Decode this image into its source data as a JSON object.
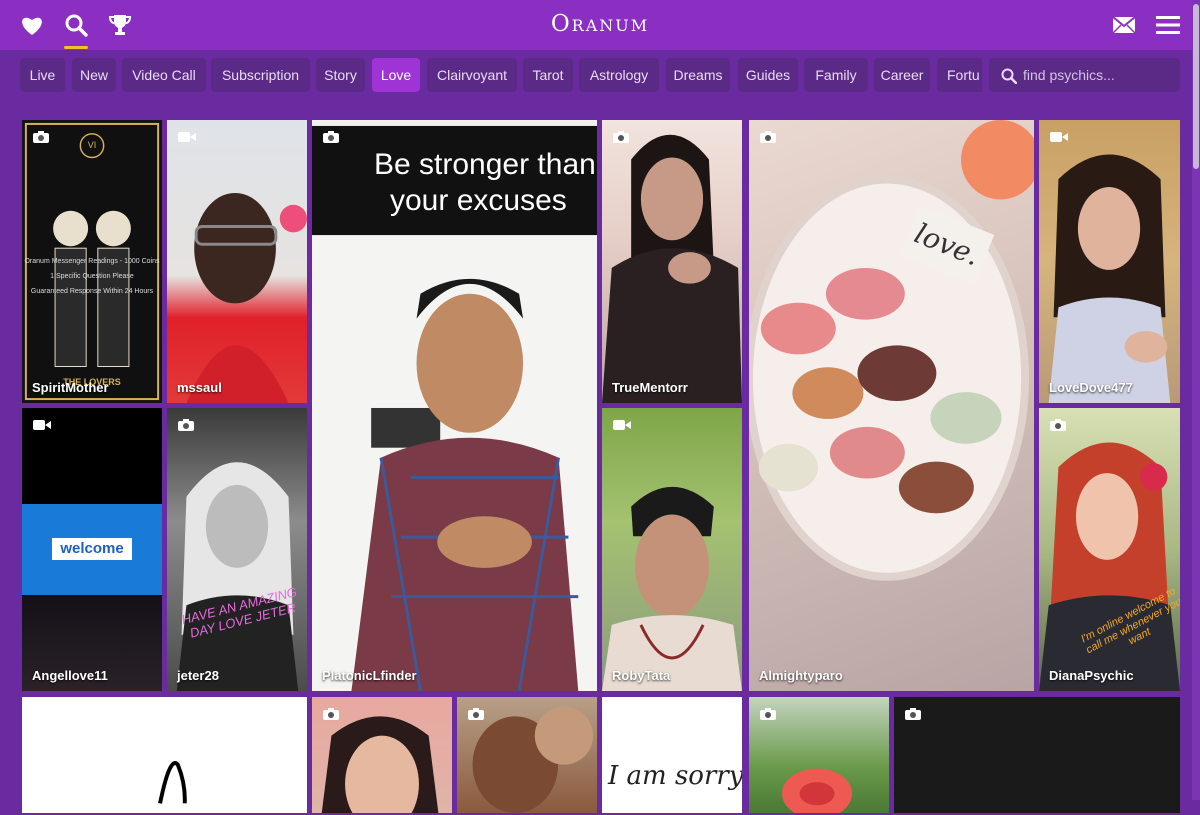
{
  "app": {
    "logo": "Oranum"
  },
  "topbar": {
    "icons": [
      "heart-icon",
      "search-icon",
      "trophy-icon",
      "mail-icon",
      "menu-icon"
    ],
    "active": "search-icon"
  },
  "filters": {
    "chips": [
      "Live",
      "New",
      "Video Call",
      "Subscription",
      "Story",
      "Love",
      "Clairvoyant",
      "Tarot",
      "Astrology",
      "Dreams",
      "Guides",
      "Family",
      "Career",
      "Fortu"
    ],
    "active": "Love"
  },
  "search": {
    "placeholder": "find psychics..."
  },
  "tiles": [
    {
      "name": "SpiritMother",
      "media": "camera-icon"
    },
    {
      "name": "mssaul",
      "media": "video-icon"
    },
    {
      "name": "PlatonicLfinder",
      "media": "camera-icon"
    },
    {
      "name": "TrueMentorr",
      "media": "camera-icon"
    },
    {
      "name": "Almightyparo",
      "media": "camera-icon"
    },
    {
      "name": "LoveDove477",
      "media": "video-icon"
    },
    {
      "name": "Angellove11",
      "media": "video-icon"
    },
    {
      "name": "jeter28",
      "media": "camera-icon"
    },
    {
      "name": "RobyTata",
      "media": "video-icon"
    },
    {
      "name": "DianaPsychic",
      "media": "camera-icon"
    },
    {
      "name": "",
      "media": ""
    },
    {
      "name": "",
      "media": "camera-icon"
    },
    {
      "name": "",
      "media": "camera-icon"
    },
    {
      "name": "",
      "media": ""
    },
    {
      "name": "",
      "media": "camera-icon"
    },
    {
      "name": "",
      "media": "camera-icon"
    }
  ],
  "tile_texts": {
    "tarot_lines": [
      "Oranum Messenger Readings - 1000 Coins",
      "1 Specific Question Please",
      "Guaranteed Response Within 24 Hours"
    ],
    "tarot_numeral": "VI",
    "tarot_card": "THE LOVERS",
    "quote_line1": "Be stronger than",
    "quote_line2": "your excuses",
    "welcome": "welcome",
    "jeter_overlay": "HAVE AN AMAZING DAY LOVE JETER",
    "diana_overlay": "I'm online welcome to call me whenever you want",
    "love_tag": "love.",
    "sorry": "I am sorry."
  },
  "colors": {
    "topbar": "#8a2fc2",
    "background": "#6a2aa0",
    "chip": "#5b2a86",
    "chip_active": "#a033d6",
    "underline": "#f4c21a"
  }
}
